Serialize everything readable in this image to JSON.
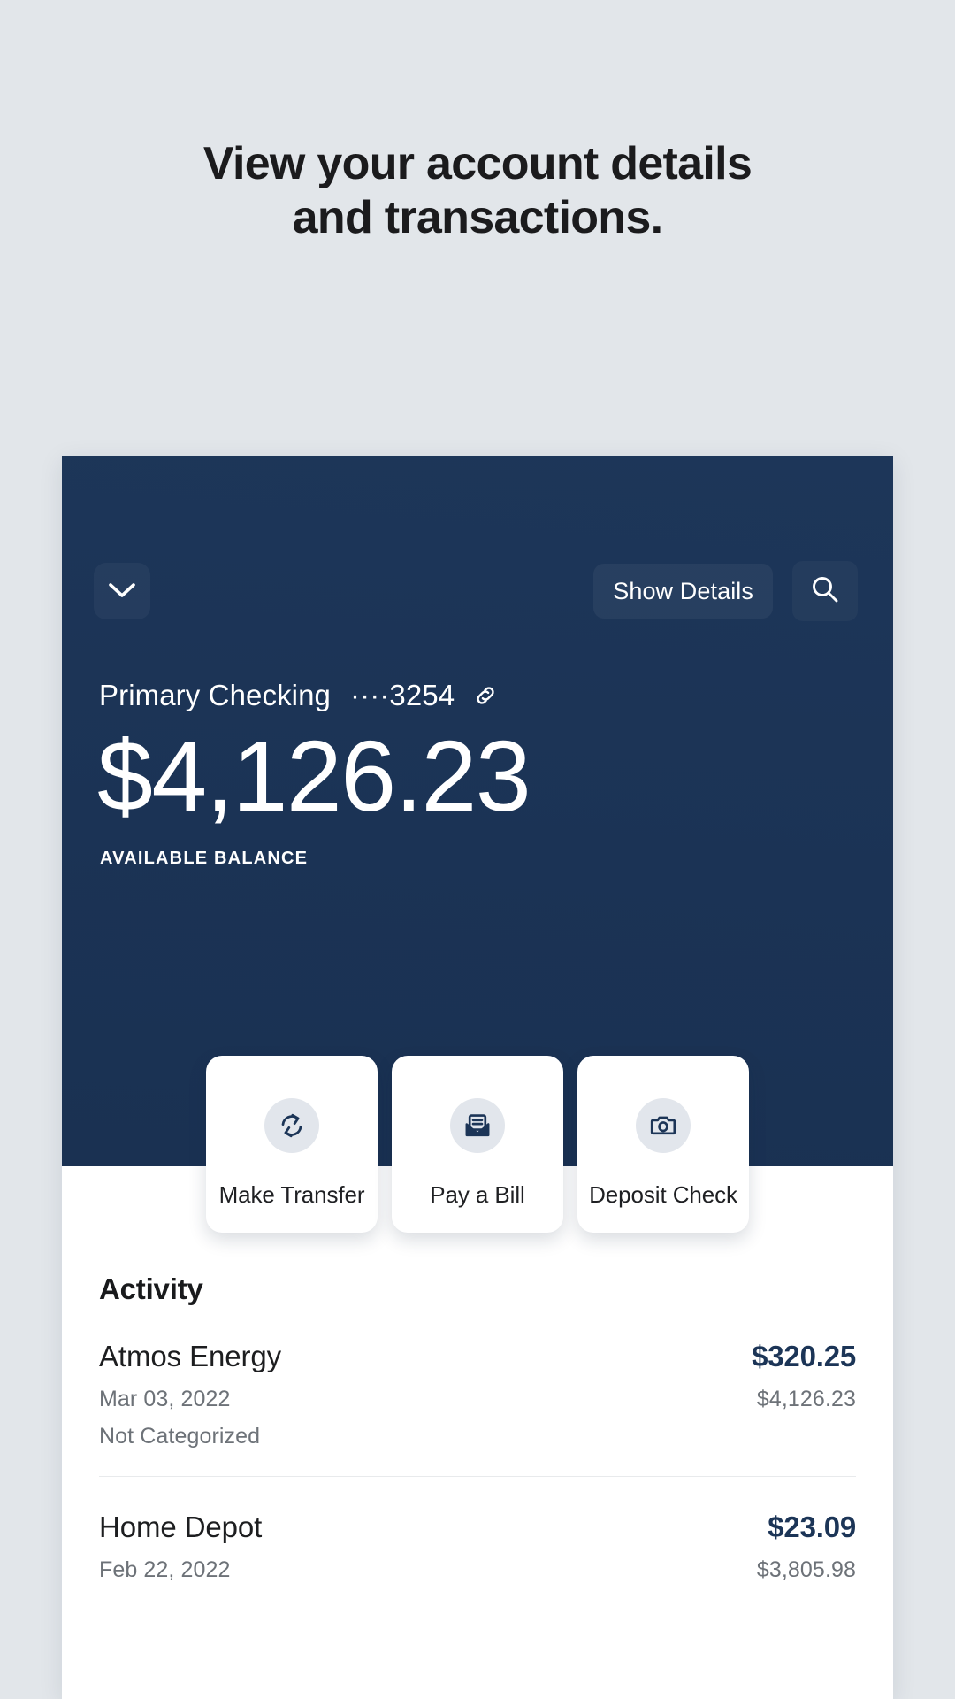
{
  "headline": {
    "line1": "View your account details",
    "line2": "and transactions."
  },
  "colors": {
    "page_background": "#e2e6ea",
    "card_navy": "#1c3557",
    "amount_navy": "#1c3557",
    "headline_text": "#1b1b1d",
    "muted_text": "#6d7278"
  },
  "card": {
    "toolbar": {
      "collapse_icon": "chevron-down-icon",
      "show_details_label": "Show Details",
      "search_icon": "search-icon"
    },
    "account": {
      "name": "Primary Checking",
      "mask": "····3254",
      "link_icon": "link-icon",
      "balance": "$4,126.23",
      "balance_label": "AVAILABLE BALANCE"
    },
    "actions": [
      {
        "label": "Make Transfer",
        "icon": "transfer-sync-icon"
      },
      {
        "label": "Pay a Bill",
        "icon": "envelope-bill-icon"
      },
      {
        "label": "Deposit Check",
        "icon": "camera-icon"
      }
    ],
    "activity": {
      "title": "Activity",
      "transactions": [
        {
          "merchant": "Atmos Energy",
          "amount": "$320.25",
          "date": "Mar 03, 2022",
          "running_balance": "$4,126.23",
          "category": "Not Categorized"
        },
        {
          "merchant": "Home Depot",
          "amount": "$23.09",
          "date": "Feb 22, 2022",
          "running_balance": "$3,805.98",
          "category": ""
        }
      ]
    }
  }
}
